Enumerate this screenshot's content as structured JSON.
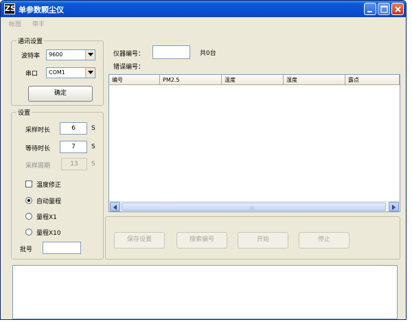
{
  "window": {
    "title": "单参数颗尘仪",
    "icon_glyph": "ZS",
    "colors": {
      "titlebar": "#0a4fd0",
      "face": "#ece9d8",
      "close": "#c5391c"
    }
  },
  "menu": [
    "帐图",
    "带丰"
  ],
  "comm": {
    "legend": "通讯设置",
    "baud_label": "波特率",
    "baud_value": "9600",
    "port_label": "串口",
    "port_value": "COM1",
    "confirm_label": "确定"
  },
  "settings": {
    "legend": "设置",
    "sample_duration_label": "采样时长",
    "sample_duration_value": "6",
    "wait_duration_label": "等待时长",
    "wait_duration_value": "7",
    "sample_period_label": "采样周期",
    "sample_period_value": "13",
    "unit": "S",
    "temp_correction_label": "温度修正",
    "auto_range_label": "自动量程",
    "range1_label": "量程X1",
    "range10_label": "量程X10",
    "batch_label": "批号",
    "batch_value": ""
  },
  "device": {
    "id_label": "仪器编号：",
    "id_value": "",
    "total_text": "共0台",
    "error_label": "错误编号："
  },
  "table": {
    "columns": [
      "编号",
      "PM2.5",
      "温度",
      "湿度",
      "露点"
    ],
    "rows": []
  },
  "actions": {
    "save": "保存设置",
    "search": "搜索编号",
    "start": "开始",
    "stop": "停止"
  },
  "output_text": "",
  "icons": [
    "app-icon",
    "minimize-icon",
    "maximize-icon",
    "close-icon",
    "dropdown-arrow-icon",
    "scroll-left-icon",
    "scroll-right-icon"
  ]
}
